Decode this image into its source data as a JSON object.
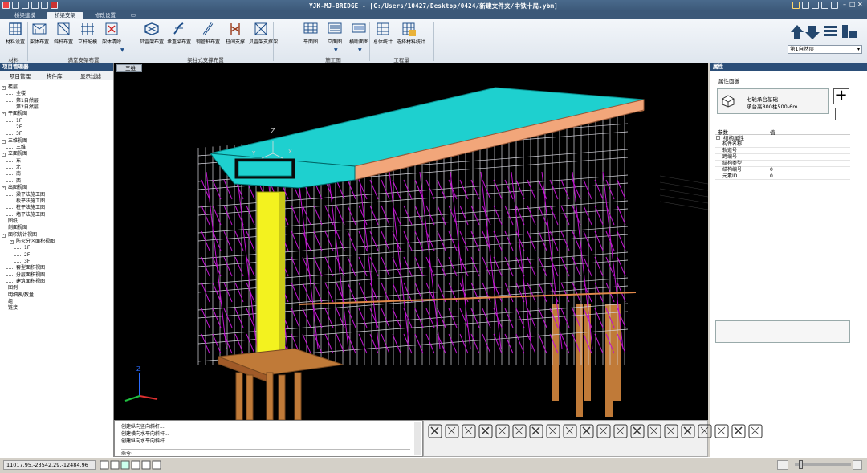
{
  "window": {
    "title": "YJK-MJ-BRIDGE - [C:/Users/10427/Desktop/0424/新建文件夹/中铁十局.ybm]",
    "controls": [
      "–",
      "□",
      "✕"
    ]
  },
  "tabs": [
    {
      "label": "桥梁建模",
      "active": false
    },
    {
      "label": "桥梁支架",
      "active": true
    },
    {
      "label": "修改设置",
      "active": false
    }
  ],
  "ribbon": {
    "buttons": [
      {
        "label": "材料设置",
        "icon": "grid-icon"
      },
      {
        "label": "架体布置",
        "icon": "frame-icon"
      },
      {
        "label": "斜杆布置",
        "icon": "diagonal-icon"
      },
      {
        "label": "立杆配模",
        "icon": "pole-icon"
      },
      {
        "label": "架体清除",
        "icon": "clear-icon"
      },
      {
        "label": "贝雷架布置",
        "icon": "bailey-icon"
      },
      {
        "label": "承重梁布置",
        "icon": "beam-icon"
      },
      {
        "label": "钢管桩布置",
        "icon": "pile-icon"
      },
      {
        "label": "柱间支撑",
        "icon": "brace-icon"
      },
      {
        "label": "贝雷架支撑架",
        "icon": "support-icon"
      },
      {
        "label": "平面图",
        "icon": "plan-icon"
      },
      {
        "label": "立面图",
        "icon": "elevation-icon"
      },
      {
        "label": "横断面图",
        "icon": "section-icon"
      },
      {
        "label": "总体统计",
        "icon": "stats-icon"
      },
      {
        "label": "选择材料统计",
        "icon": "material-stats-icon"
      }
    ],
    "groups": [
      {
        "label": "材料"
      },
      {
        "label": "满堂支架布置"
      },
      {
        "label": "梁柱式支撑布置"
      },
      {
        "label": "施工图"
      },
      {
        "label": "工程量"
      }
    ],
    "floor_select": "第1自然层"
  },
  "left_panel": {
    "title": "项目管理器",
    "tabs": [
      "项目管理",
      "构件库",
      "显示过滤"
    ],
    "tree": [
      {
        "label": "楼层",
        "level": 0,
        "exp": "-"
      },
      {
        "label": "全楼",
        "level": 1
      },
      {
        "label": "第1自然层",
        "level": 1
      },
      {
        "label": "第2自然层",
        "level": 1
      },
      {
        "label": "平面视图",
        "level": 0,
        "exp": "-"
      },
      {
        "label": "1F",
        "level": 1
      },
      {
        "label": "2F",
        "level": 1
      },
      {
        "label": "3F",
        "level": 1
      },
      {
        "label": "三维视图",
        "level": 0,
        "exp": "-"
      },
      {
        "label": "三维",
        "level": 1
      },
      {
        "label": "立面视图",
        "level": 0,
        "exp": "-"
      },
      {
        "label": "东",
        "level": 1
      },
      {
        "label": "北",
        "level": 1
      },
      {
        "label": "南",
        "level": 1
      },
      {
        "label": "西",
        "level": 1
      },
      {
        "label": "出图视图",
        "level": 0,
        "exp": "-"
      },
      {
        "label": "梁平法施工图",
        "level": 1
      },
      {
        "label": "板平法施工图",
        "level": 1
      },
      {
        "label": "柱平法施工图",
        "level": 1
      },
      {
        "label": "墙平法施工图",
        "level": 1
      },
      {
        "label": "图纸",
        "level": 0
      },
      {
        "label": "剖面视图",
        "level": 0
      },
      {
        "label": "面积统计视图",
        "level": 0,
        "exp": "-"
      },
      {
        "label": "防火分区面积视图",
        "level": 1,
        "exp": "-"
      },
      {
        "label": "1F",
        "level": 2
      },
      {
        "label": "2F",
        "level": 2
      },
      {
        "label": "3F",
        "level": 2
      },
      {
        "label": "套型面积视图",
        "level": 1
      },
      {
        "label": "分层面积视图",
        "level": 1
      },
      {
        "label": "建筑面积视图",
        "level": 1
      },
      {
        "label": "图例",
        "level": 0
      },
      {
        "label": "明细表/数量",
        "level": 0
      },
      {
        "label": "组",
        "level": 0
      },
      {
        "label": "链接",
        "level": 0
      }
    ]
  },
  "viewport": {
    "tab_label": "三维",
    "axis_x": "X",
    "axis_y": "Y",
    "axis_z": "Z"
  },
  "right_panel": {
    "title": "属性",
    "subtitle": "属性面板",
    "type_line1": "七轮承台基础",
    "type_line2": "承台高800柱500-6m",
    "table_header": [
      "参数",
      "值"
    ],
    "group_label": "结构属性",
    "rows": [
      {
        "k": "构件名称",
        "v": ""
      },
      {
        "k": "轨道号",
        "v": ""
      },
      {
        "k": "跨编号",
        "v": ""
      },
      {
        "k": "结构类型",
        "v": ""
      },
      {
        "k": "结构编号",
        "v": "0"
      },
      {
        "k": "元素ID",
        "v": "0"
      }
    ]
  },
  "command": {
    "lines": [
      "创建纵向竖向斜杆...",
      "创建横向水平向斜杆...",
      "创建纵向水平向斜杆..."
    ],
    "prompt_label": "命令:"
  },
  "status": {
    "coords": "11017.95,-23542.29,-12484.96"
  },
  "colors": {
    "deck": "#1ed0cf",
    "pier": "#f3f21f",
    "scaffold": "#d8d8e0",
    "brace": "#c010d0",
    "pile": "#c07a38",
    "titlebar": "#3b5878"
  }
}
